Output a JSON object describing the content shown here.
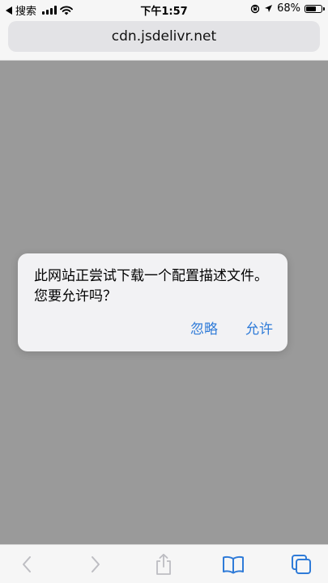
{
  "status_bar": {
    "back_label": "搜索",
    "time": "下午1:57",
    "battery_text": "68%",
    "battery_level": 0.68
  },
  "url_bar": {
    "url": "cdn.jsdelivr.net"
  },
  "alert": {
    "message_line1": "此网站正尝试下载一个配置描述文件。",
    "message_line2": "您要允许吗？",
    "ignore_label": "忽略",
    "allow_label": "允许"
  },
  "toolbar": {
    "icons": [
      "chevron-left-icon",
      "chevron-right-icon",
      "share-icon",
      "bookmarks-icon",
      "tabs-icon"
    ]
  },
  "colors": {
    "accent": "#2f7bd8",
    "page_overlay": "#9a9a9a",
    "bar_background": "#f6f6f6",
    "alert_background": "#f2f2f4"
  }
}
